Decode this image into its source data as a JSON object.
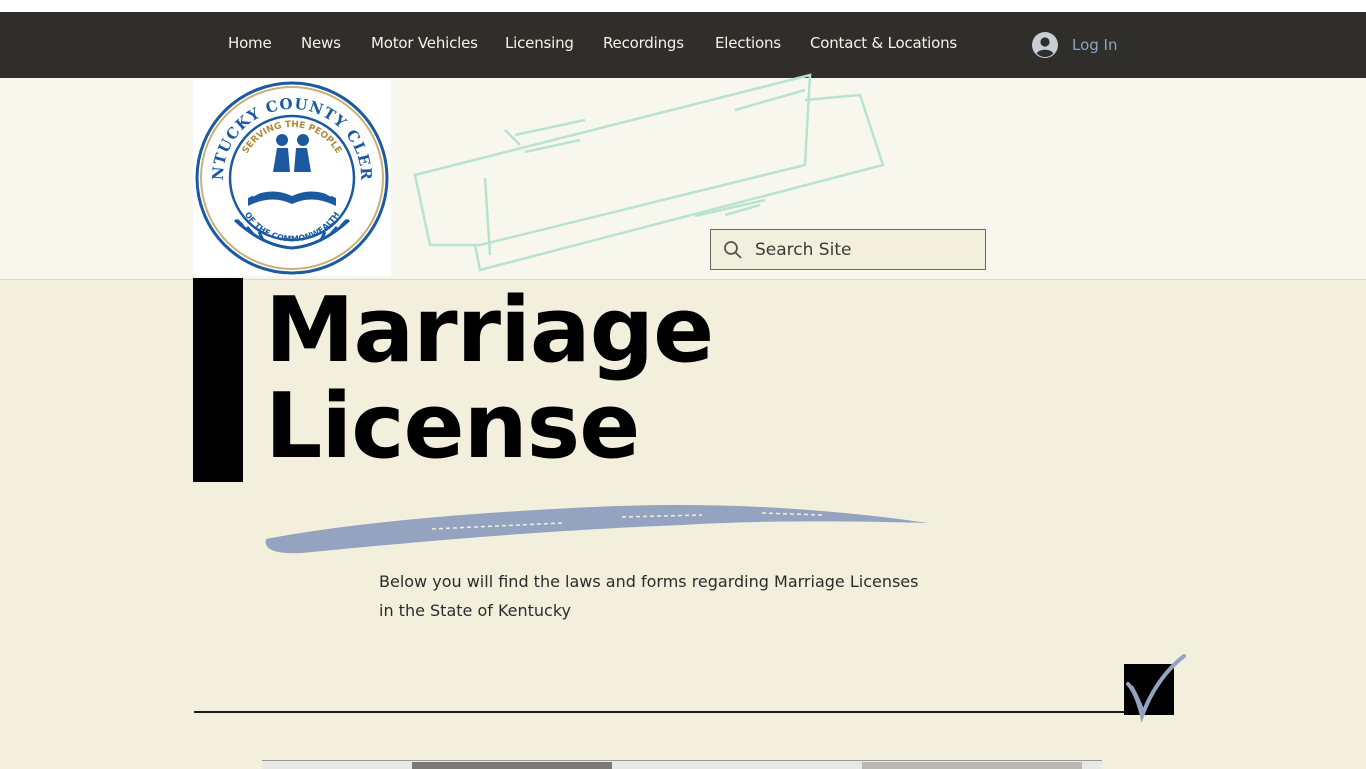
{
  "nav": {
    "items": [
      {
        "label": "Home"
      },
      {
        "label": "News"
      },
      {
        "label": "Motor Vehicles"
      },
      {
        "label": "Licensing"
      },
      {
        "label": "Recordings"
      },
      {
        "label": "Elections"
      },
      {
        "label": "Contact & Locations"
      }
    ],
    "login_label": "Log In",
    "login_icon": "user-avatar-icon"
  },
  "logo": {
    "text_top": "KENTUCKY COUNTY CLERKS",
    "text_inner": "SERVING THE PEOPLE",
    "text_bottom": "OF THE COMMONWEALTH",
    "ring_color": "#1b5aa0"
  },
  "search": {
    "placeholder": "Search Site",
    "icon": "search-icon"
  },
  "page": {
    "title_line1": "Marriage",
    "title_line2": "License",
    "intro_line1": "Below you will find the laws and forms regarding Marriage Licenses",
    "intro_line2": "in the State of Kentucky"
  },
  "colors": {
    "nav_bg": "#2f2e2a",
    "page_bg": "#f2f0dc",
    "header_bg": "#f8f7ee",
    "accent_brush": "#94a3bf",
    "banner_stroke": "#b9e3cf",
    "login_text": "#8ea3c2"
  }
}
